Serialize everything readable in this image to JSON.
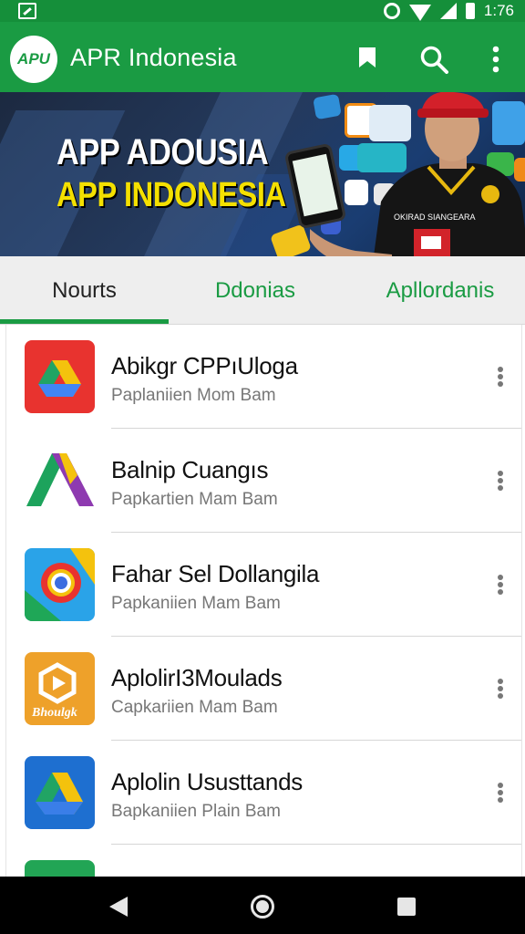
{
  "status_bar": {
    "time": "1:76",
    "icons": [
      "photo-icon",
      "sync-icon",
      "wifi-icon",
      "signal-icon",
      "battery-icon"
    ]
  },
  "app_bar": {
    "logo_text": "APU",
    "title": "APR Indonesia",
    "icons": [
      "bookmark-icon",
      "search-icon",
      "more-vert-icon"
    ],
    "color": "#1a9b43"
  },
  "banner": {
    "line1": "APP ADOUSIA",
    "line2": "APP INDONESIA",
    "shirt_text": "OKIRAD SIANGEARA"
  },
  "tabs": [
    {
      "label": "Nourts",
      "selected": true
    },
    {
      "label": "Ddonias",
      "selected": false
    },
    {
      "label": "Apllordanis",
      "selected": false
    }
  ],
  "apps": [
    {
      "title": "Abikgr CPPıUloga",
      "subtitle": "Paplaniien Mom Bam",
      "icon": "drive-red-icon"
    },
    {
      "title": "Balnip Cuangıs",
      "subtitle": "Papkartien Mam Bam",
      "icon": "triangle-logo-icon"
    },
    {
      "title": "Fahar Sel Dollangila",
      "subtitle": "Papkaniien Mam Bam",
      "icon": "chrome-style-icon"
    },
    {
      "title": "AplolirI3Moulads",
      "subtitle": "Capkariien Mam Bam",
      "icon": "bhoulgk-play-icon",
      "icon_text": "Bhoulgk"
    },
    {
      "title": "Aplolin Ususttands",
      "subtitle": "Bapkaniien Plain Bam",
      "icon": "drive-blue-icon"
    },
    {
      "title": "",
      "subtitle": "",
      "icon": "green-partial-icon"
    }
  ],
  "nav_bar": {
    "icons": [
      "back-icon",
      "home-icon",
      "recents-icon"
    ]
  }
}
